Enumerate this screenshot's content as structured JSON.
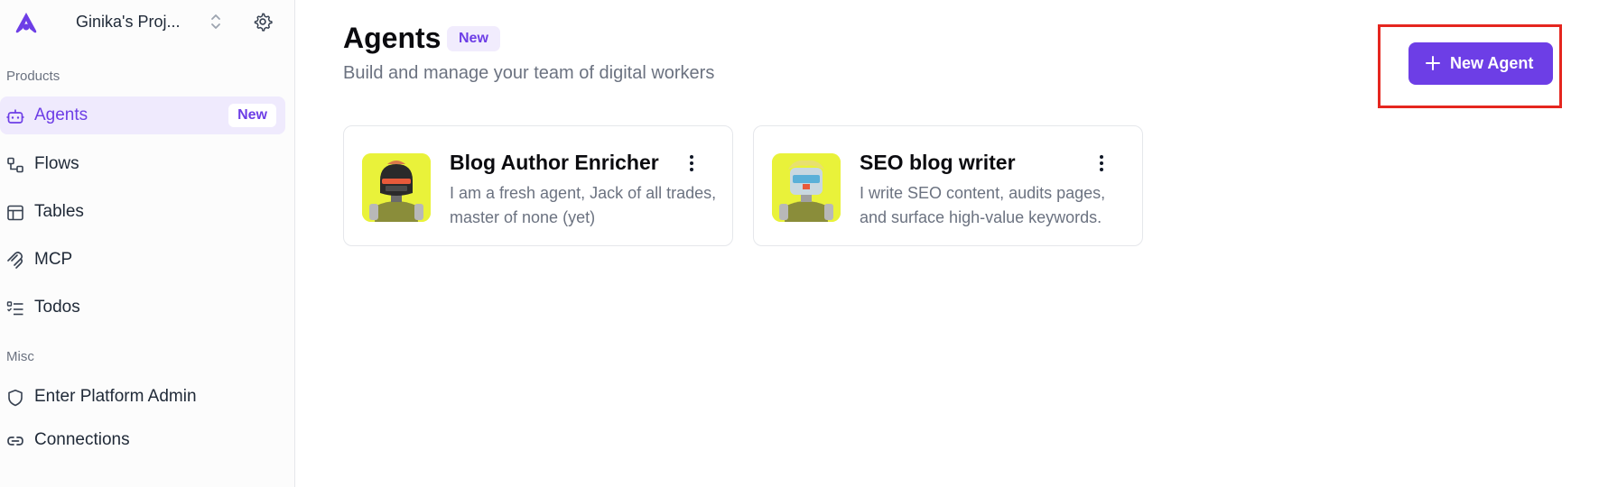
{
  "sidebar": {
    "project_name": "Ginika's Proj...",
    "sections": [
      {
        "label": "Products"
      },
      {
        "label": "Misc"
      }
    ],
    "items": [
      {
        "label": "Agents",
        "badge": "New",
        "icon": "robot-icon"
      },
      {
        "label": "Flows",
        "icon": "flows-icon"
      },
      {
        "label": "Tables",
        "icon": "table-icon"
      },
      {
        "label": "MCP",
        "icon": "mcp-icon"
      },
      {
        "label": "Todos",
        "icon": "todos-icon"
      },
      {
        "label": "Enter Platform Admin",
        "icon": "shield-icon"
      },
      {
        "label": "Connections",
        "icon": "link-icon"
      }
    ]
  },
  "main": {
    "title": "Agents",
    "title_badge": "New",
    "subtitle": "Build and manage your team of digital workers",
    "new_agent_label": "New Agent",
    "cards": [
      {
        "title": "Blog Author Enricher",
        "description": "I am a fresh agent, Jack of all trades, master of none (yet)"
      },
      {
        "title": "SEO blog writer",
        "description": "I write SEO content, audits pages, and surface high-value keywords."
      }
    ]
  },
  "colors": {
    "accent": "#6d3ee6",
    "accent_light": "#efeafd",
    "highlight": "#e5261f",
    "avatar_bg": "#e9f23a"
  }
}
